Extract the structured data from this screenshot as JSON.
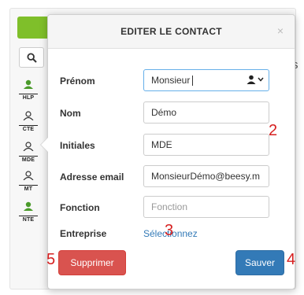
{
  "background": {
    "right_partial_text": "s",
    "levels": [
      {
        "label": "HLP",
        "color": "#4a9a2a"
      },
      {
        "label": "CTE",
        "color": "#333333"
      },
      {
        "label": "MDE",
        "color": "#333333"
      },
      {
        "label": "MT",
        "color": "#333333"
      },
      {
        "label": "NTE",
        "color": "#4a9a2a"
      }
    ]
  },
  "dialog": {
    "title": "EDITER LE CONTACT",
    "close_label": "×",
    "fields": {
      "prenom": {
        "label": "Prénom",
        "value": "Monsieur"
      },
      "nom": {
        "label": "Nom",
        "value": "Démo"
      },
      "initiales": {
        "label": "Initiales",
        "value": "MDE"
      },
      "email": {
        "label": "Adresse email",
        "value": "MonsieurDémo@beesy.m"
      },
      "fonction": {
        "label": "Fonction",
        "placeholder": "Fonction"
      },
      "entreprise": {
        "label": "Entreprise",
        "link": "Sélectionnez"
      }
    },
    "delete_label": "Supprimer",
    "save_label": "Sauver"
  },
  "annotations": [
    "2",
    "3",
    "4",
    "5"
  ],
  "colors": {
    "delete": "#d9534f",
    "save": "#337ab7",
    "link": "#337ab7",
    "annotation": "#d62020",
    "green": "#7fbf2a"
  }
}
